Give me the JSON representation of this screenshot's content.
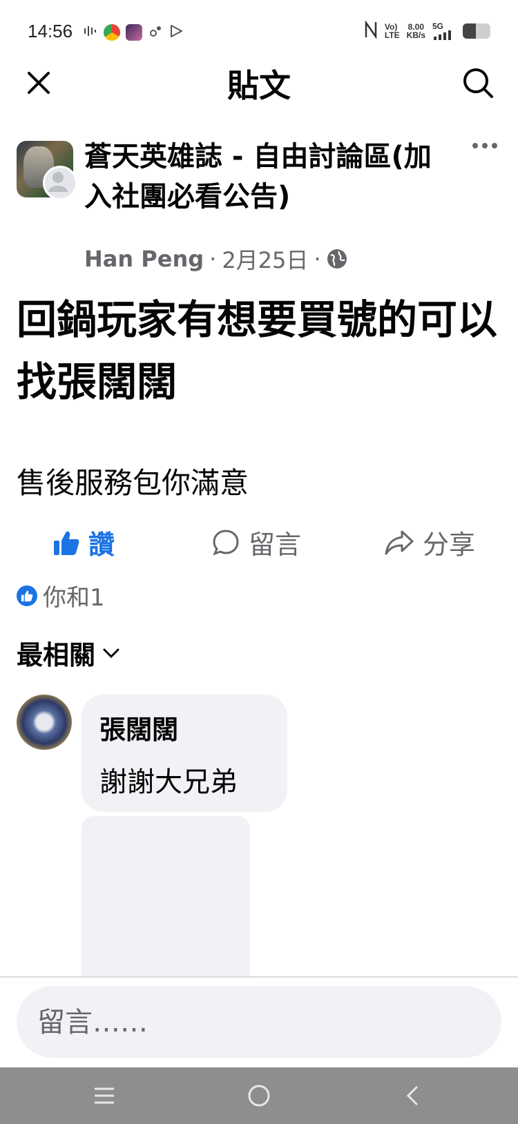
{
  "status_bar": {
    "time": "14:56",
    "network": "5G",
    "speed": "8.00",
    "speed_unit": "KB/s",
    "volte": "Vo)",
    "lte": "LTE"
  },
  "header": {
    "title": "貼文"
  },
  "post": {
    "group_name": "蒼天英雄誌 - 自由討論區(加入社團必看公告)",
    "author": "Han Peng",
    "date": "2月25日",
    "title": "回鍋玩家有想要買號的可以找張闊闊",
    "body": "售後服務包你滿意"
  },
  "actions": {
    "like": "讚",
    "comment": "留言",
    "share": "分享"
  },
  "reactions": {
    "summary": "你和1"
  },
  "comments_sort": {
    "label": "最相關"
  },
  "comments": [
    {
      "name": "張闊闊",
      "text": "謝謝大兄弟"
    }
  ],
  "composer": {
    "placeholder": "留言……"
  },
  "colors": {
    "like_blue": "#1b74e4",
    "secondary_text": "#65676b",
    "bubble_bg": "#f0f2f5",
    "nav_bar": "#8c8e90"
  }
}
